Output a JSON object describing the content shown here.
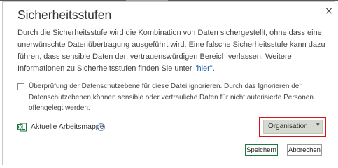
{
  "dialog": {
    "title": "Sicherheitsstufen",
    "description_main": "Durch die Sicherheitsstufe wird die Kombination von Daten sichergestellt, ohne dass eine unerwünschte Datenübertragung ausgeführt wird. Eine falsche Sicherheitsstufe kann dazu führen, dass sensible Daten den vertrauenswürdigen Bereich verlassen. Weitere Informationen zu Sicherheitsstufen finden Sie unter ",
    "description_link": "\"hier\"",
    "description_end": ".",
    "close_glyph": "×"
  },
  "checkbox": {
    "checked": false,
    "label": "Überprüfung der Datenschutzebene für diese Datei ignorieren. Durch das Ignorieren der Datenschutzebenen können sensible oder vertrauliche Daten für nicht autorisierte Personen offengelegt werden."
  },
  "workbook": {
    "label": "Aktuelle Arbeitsmappe",
    "icon": "excel-icon",
    "info_glyph": "i",
    "privacy_level": "Organisation",
    "caret_glyph": "▼"
  },
  "buttons": {
    "save": "Speichern",
    "cancel": "Abbrechen"
  },
  "colors": {
    "highlight": "#d5141b",
    "excel_green": "#1e7a45",
    "select_bg": "#d6d9cf",
    "link": "#1a5fb4"
  }
}
